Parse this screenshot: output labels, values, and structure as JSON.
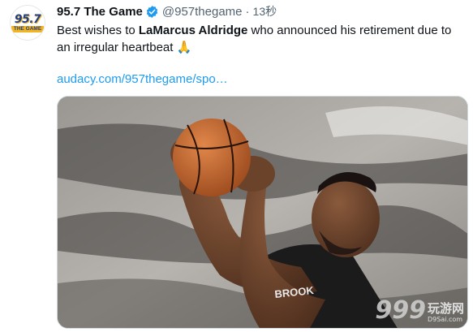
{
  "account": {
    "logo_top": "95.7",
    "logo_bottom": "THE GAME",
    "display_name": "95.7 The Game",
    "handle": "@957thegame",
    "separator": "·",
    "time": "13秒"
  },
  "tweet": {
    "text_before": "Best wishes to ",
    "text_bold": "LaMarcus Aldridge",
    "text_after": " who announced his retirement due to an irregular heartbeat",
    "emoji": "🙏",
    "link": "audacy.com/957thegame/spo…"
  },
  "media": {
    "jersey_text": "BROOK",
    "watermark_num": "999",
    "watermark_cn": "玩游网",
    "watermark_site": "D9Sai.com"
  },
  "colors": {
    "verified": "#1d9bf0",
    "link": "#1d9bf0",
    "brand_blue": "#1f3f8f",
    "brand_gold": "#f2b51d"
  },
  "icons": [
    "verified-badge-icon",
    "pray-emoji-icon"
  ]
}
